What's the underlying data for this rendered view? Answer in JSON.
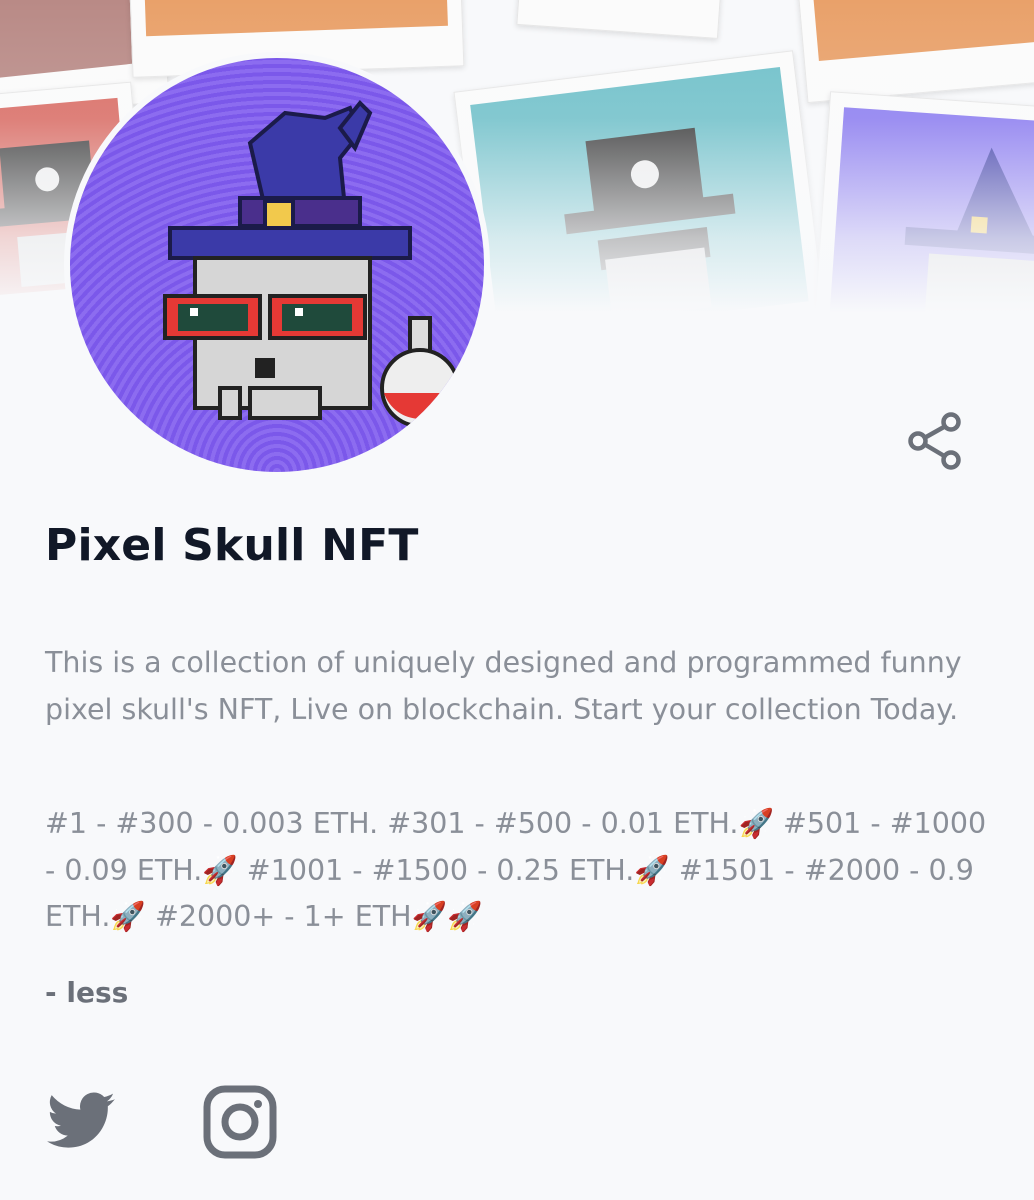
{
  "collection": {
    "name": "Pixel Skull NFT",
    "description": "This is a collection of uniquely designed and programmed funny pixel skull's NFT, Live on blockchain. Start your collection Today.",
    "pricing": "#1 - #300 - 0.003 ETH. #301 - #500 - 0.01 ETH.🚀 #501 - #1000 - 0.09 ETH.🚀 #1001 - #1500 - 0.25 ETH.🚀 #1501 - #2000 - 0.9 ETH.🚀 #2000+ - 1+ ETH🚀🚀",
    "toggle_label": "- less"
  },
  "icons": {
    "share": "share-icon",
    "twitter": "twitter-icon",
    "instagram": "instagram-icon"
  },
  "colors": {
    "background": "#f8f9fb",
    "title": "#111827",
    "body_text": "#8a8f98",
    "icon": "#6b7079",
    "avatar_bg": "#7b58ea",
    "hat": "#3b3aa8"
  }
}
